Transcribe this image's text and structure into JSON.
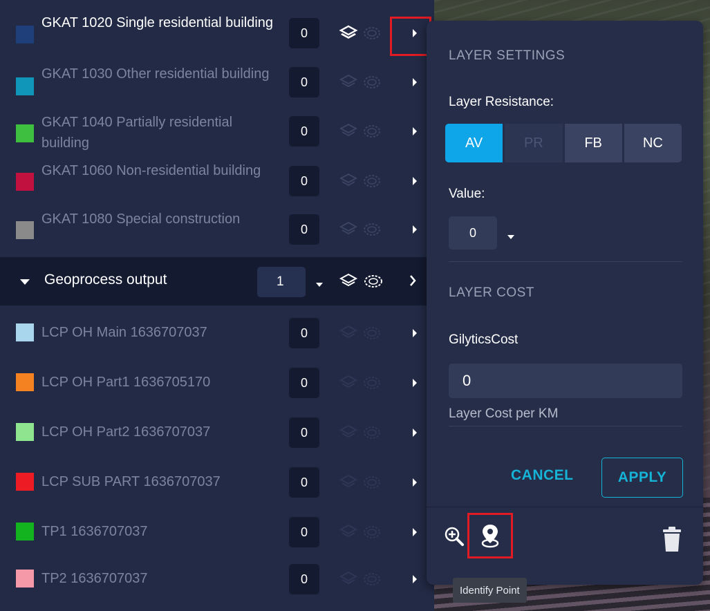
{
  "layers_top": [
    {
      "label": "GKAT 1020 Single residential building",
      "count": "0",
      "color": "#1e3f7a",
      "active": true
    },
    {
      "label": "GKAT 1030 Other residential building",
      "count": "0",
      "color": "#0f96b8",
      "active": false
    },
    {
      "label": "GKAT 1040 Partially residential building",
      "count": "0",
      "color": "#3fbf3f",
      "active": false
    },
    {
      "label": "GKAT 1060 Non-residential building",
      "count": "0",
      "color": "#c0113f",
      "active": false
    },
    {
      "label": "GKAT 1080 Special construction",
      "count": "0",
      "color": "#8a8a8a",
      "active": false
    }
  ],
  "group": {
    "label": "Geoprocess output",
    "count": "1"
  },
  "layers_group": [
    {
      "label": "LCP OH Main 1636707037",
      "count": "0",
      "color": "#a9d6ec"
    },
    {
      "label": "LCP OH Part1 1636705170",
      "count": "0",
      "color": "#f58220"
    },
    {
      "label": "LCP OH Part2 1636707037",
      "count": "0",
      "color": "#8fe58f"
    },
    {
      "label": "LCP SUB PART 1636707037",
      "count": "0",
      "color": "#ed1c24"
    },
    {
      "label": "TP1 1636707037",
      "count": "0",
      "color": "#12b31f"
    },
    {
      "label": "TP2 1636707037",
      "count": "0",
      "color": "#f598a8"
    }
  ],
  "settings": {
    "heading": "LAYER SETTINGS",
    "resistance_label": "Layer Resistance:",
    "resistance_options": [
      "AV",
      "PR",
      "FB",
      "NC"
    ],
    "resistance_selected": "AV",
    "value_label": "Value:",
    "value": "0",
    "cost_heading": "LAYER COST",
    "cost_field_label": "GilyticsCost",
    "cost_value": "0",
    "cost_hint": "Layer Cost per KM",
    "cancel_label": "CANCEL",
    "apply_label": "APPLY"
  },
  "tooltip": "Identify Point",
  "colors": {
    "accent": "#0ea5e9",
    "action": "#16b3d6",
    "highlight": "#e01b24",
    "panel": "#252d48",
    "list": "#222a45"
  },
  "icons": {
    "layers": "layers-icon",
    "visibility": "visibility-icon",
    "chevron": "chevron-right-icon",
    "zoom": "zoom-in-icon",
    "identify": "identify-point-icon",
    "trash": "trash-icon"
  }
}
